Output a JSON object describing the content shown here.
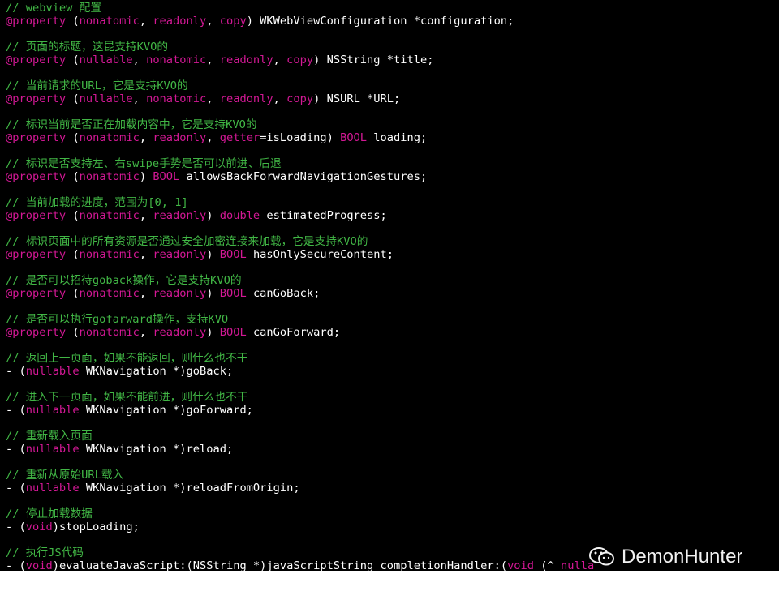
{
  "editor": {
    "colors": {
      "background": "#000000",
      "comment": "#41b645",
      "keyword": "#d31895",
      "text": "#ffffff"
    },
    "blocks": [
      {
        "comment": "// webview 配置",
        "code": [
          {
            "t": "@property",
            "k": true
          },
          {
            "t": " (",
            "k": false
          },
          {
            "t": "nonatomic",
            "k": true
          },
          {
            "t": ", ",
            "k": false
          },
          {
            "t": "readonly",
            "k": true
          },
          {
            "t": ", ",
            "k": false
          },
          {
            "t": "copy",
            "k": true
          },
          {
            "t": ") WKWebViewConfiguration *configuration;",
            "k": false
          }
        ]
      },
      {
        "comment": "// 页面的标题，这昆支持KVO的",
        "code": [
          {
            "t": "@property",
            "k": true
          },
          {
            "t": " (",
            "k": false
          },
          {
            "t": "nullable",
            "k": true
          },
          {
            "t": ", ",
            "k": false
          },
          {
            "t": "nonatomic",
            "k": true
          },
          {
            "t": ", ",
            "k": false
          },
          {
            "t": "readonly",
            "k": true
          },
          {
            "t": ", ",
            "k": false
          },
          {
            "t": "copy",
            "k": true
          },
          {
            "t": ") NSString *title;",
            "k": false
          }
        ]
      },
      {
        "comment": "// 当前请求的URL，它是支持KVO的",
        "code": [
          {
            "t": "@property",
            "k": true
          },
          {
            "t": " (",
            "k": false
          },
          {
            "t": "nullable",
            "k": true
          },
          {
            "t": ", ",
            "k": false
          },
          {
            "t": "nonatomic",
            "k": true
          },
          {
            "t": ", ",
            "k": false
          },
          {
            "t": "readonly",
            "k": true
          },
          {
            "t": ", ",
            "k": false
          },
          {
            "t": "copy",
            "k": true
          },
          {
            "t": ") NSURL *URL;",
            "k": false
          }
        ]
      },
      {
        "comment": "// 标识当前是否正在加载内容中，它是支持KVO的",
        "code": [
          {
            "t": "@property",
            "k": true
          },
          {
            "t": " (",
            "k": false
          },
          {
            "t": "nonatomic",
            "k": true
          },
          {
            "t": ", ",
            "k": false
          },
          {
            "t": "readonly",
            "k": true
          },
          {
            "t": ", ",
            "k": false
          },
          {
            "t": "getter",
            "k": true
          },
          {
            "t": "=isLoading) ",
            "k": false
          },
          {
            "t": "BOOL",
            "k": true
          },
          {
            "t": " loading;",
            "k": false
          }
        ]
      },
      {
        "comment": "// 标识是否支持左、右swipe手势是否可以前进、后退",
        "code": [
          {
            "t": "@property",
            "k": true
          },
          {
            "t": " (",
            "k": false
          },
          {
            "t": "nonatomic",
            "k": true
          },
          {
            "t": ") ",
            "k": false
          },
          {
            "t": "BOOL",
            "k": true
          },
          {
            "t": " allowsBackForwardNavigationGestures;",
            "k": false
          }
        ]
      },
      {
        "comment": "// 当前加载的进度，范围为[0, 1]",
        "code": [
          {
            "t": "@property",
            "k": true
          },
          {
            "t": " (",
            "k": false
          },
          {
            "t": "nonatomic",
            "k": true
          },
          {
            "t": ", ",
            "k": false
          },
          {
            "t": "readonly",
            "k": true
          },
          {
            "t": ") ",
            "k": false
          },
          {
            "t": "double",
            "k": true
          },
          {
            "t": " estimatedProgress;",
            "k": false
          }
        ]
      },
      {
        "comment": "// 标识页面中的所有资源是否通过安全加密连接来加载，它是支持KVO的",
        "code": [
          {
            "t": "@property",
            "k": true
          },
          {
            "t": " (",
            "k": false
          },
          {
            "t": "nonatomic",
            "k": true
          },
          {
            "t": ", ",
            "k": false
          },
          {
            "t": "readonly",
            "k": true
          },
          {
            "t": ") ",
            "k": false
          },
          {
            "t": "BOOL",
            "k": true
          },
          {
            "t": " hasOnlySecureContent;",
            "k": false
          }
        ]
      },
      {
        "comment": "// 是否可以招待goback操作，它是支持KVO的",
        "code": [
          {
            "t": "@property",
            "k": true
          },
          {
            "t": " (",
            "k": false
          },
          {
            "t": "nonatomic",
            "k": true
          },
          {
            "t": ", ",
            "k": false
          },
          {
            "t": "readonly",
            "k": true
          },
          {
            "t": ") ",
            "k": false
          },
          {
            "t": "BOOL",
            "k": true
          },
          {
            "t": " canGoBack;",
            "k": false
          }
        ]
      },
      {
        "comment": "// 是否可以执行gofarward操作，支持KVO",
        "code": [
          {
            "t": "@property",
            "k": true
          },
          {
            "t": " (",
            "k": false
          },
          {
            "t": "nonatomic",
            "k": true
          },
          {
            "t": ", ",
            "k": false
          },
          {
            "t": "readonly",
            "k": true
          },
          {
            "t": ") ",
            "k": false
          },
          {
            "t": "BOOL",
            "k": true
          },
          {
            "t": " canGoForward;",
            "k": false
          }
        ]
      },
      {
        "comment": "// 返回上一页面，如果不能返回，则什么也不干",
        "code": [
          {
            "t": "- (",
            "k": false
          },
          {
            "t": "nullable",
            "k": true
          },
          {
            "t": " WKNavigation *)goBack;",
            "k": false
          }
        ]
      },
      {
        "comment": "// 进入下一页面，如果不能前进，则什么也不干",
        "code": [
          {
            "t": "- (",
            "k": false
          },
          {
            "t": "nullable",
            "k": true
          },
          {
            "t": " WKNavigation *)goForward;",
            "k": false
          }
        ]
      },
      {
        "comment": "// 重新载入页面",
        "code": [
          {
            "t": "- (",
            "k": false
          },
          {
            "t": "nullable",
            "k": true
          },
          {
            "t": " WKNavigation *)reload;",
            "k": false
          }
        ]
      },
      {
        "comment": "// 重新从原始URL载入",
        "code": [
          {
            "t": "- (",
            "k": false
          },
          {
            "t": "nullable",
            "k": true
          },
          {
            "t": " WKNavigation *)reloadFromOrigin;",
            "k": false
          }
        ]
      },
      {
        "comment": "// 停止加载数据",
        "code": [
          {
            "t": "- (",
            "k": false
          },
          {
            "t": "void",
            "k": true
          },
          {
            "t": ")stopLoading;",
            "k": false
          }
        ]
      },
      {
        "comment": "// 执行JS代码",
        "code": [
          {
            "t": "- (",
            "k": false
          },
          {
            "t": "void",
            "k": true
          },
          {
            "t": ")evaluateJavaScript:(NSString *)javaScriptString completionHandler:(",
            "k": false
          },
          {
            "t": "void",
            "k": true
          },
          {
            "t": " (^ ",
            "k": false
          },
          {
            "t": "nulla",
            "k": true
          }
        ]
      }
    ]
  },
  "watermark": {
    "text": "DemonHunter",
    "icon": "wechat-icon"
  }
}
